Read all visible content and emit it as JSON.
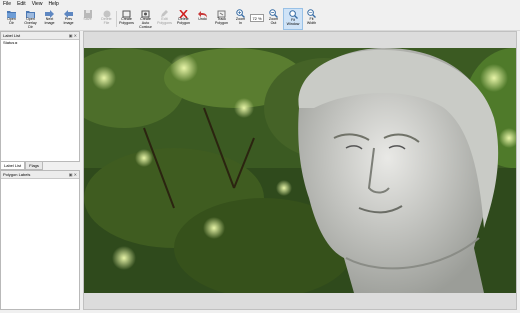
{
  "menu": [
    "File",
    "Edit",
    "View",
    "Help"
  ],
  "toolbar": {
    "buttons": [
      {
        "label": "Open\nDir",
        "icon": "folder-icon"
      },
      {
        "label": "Open\nOverlay\nDir",
        "icon": "folder-overlay-icon"
      },
      {
        "label": "Next\nImage",
        "icon": "next-arrow-icon"
      },
      {
        "label": "Prev\nImage",
        "icon": "prev-arrow-icon"
      },
      {
        "label": "Save",
        "icon": "save-icon"
      },
      {
        "label": "Delete\nFile",
        "icon": "delete-file-icon"
      },
      {
        "label": "Create\nPolygons",
        "icon": "create-polygon-icon"
      },
      {
        "label": "Create\nAuto\nContour",
        "icon": "auto-contour-icon"
      },
      {
        "label": "Edit\nPolygons",
        "icon": "edit-polygon-icon"
      },
      {
        "label": "Delete\nPolygon",
        "icon": "delete-polygon-icon"
      },
      {
        "label": "Undo",
        "icon": "undo-icon"
      },
      {
        "label": "Track\nPolygon",
        "icon": "track-polygon-icon"
      },
      {
        "label": "Zoom\nIn",
        "icon": "zoom-in-icon"
      },
      {
        "label": "Zoom\nOut",
        "icon": "zoom-out-icon"
      },
      {
        "label": "Fit\nWindow",
        "icon": "fit-window-icon"
      },
      {
        "label": "Fit\nWidth",
        "icon": "fit-width-icon"
      }
    ],
    "zoom_value": "72 %"
  },
  "label_list": {
    "title": "Label List",
    "status_label": "Status ▸"
  },
  "tabs": [
    "Label List",
    "Flags"
  ],
  "polygon_labels": {
    "title": "Polygon Labels"
  }
}
